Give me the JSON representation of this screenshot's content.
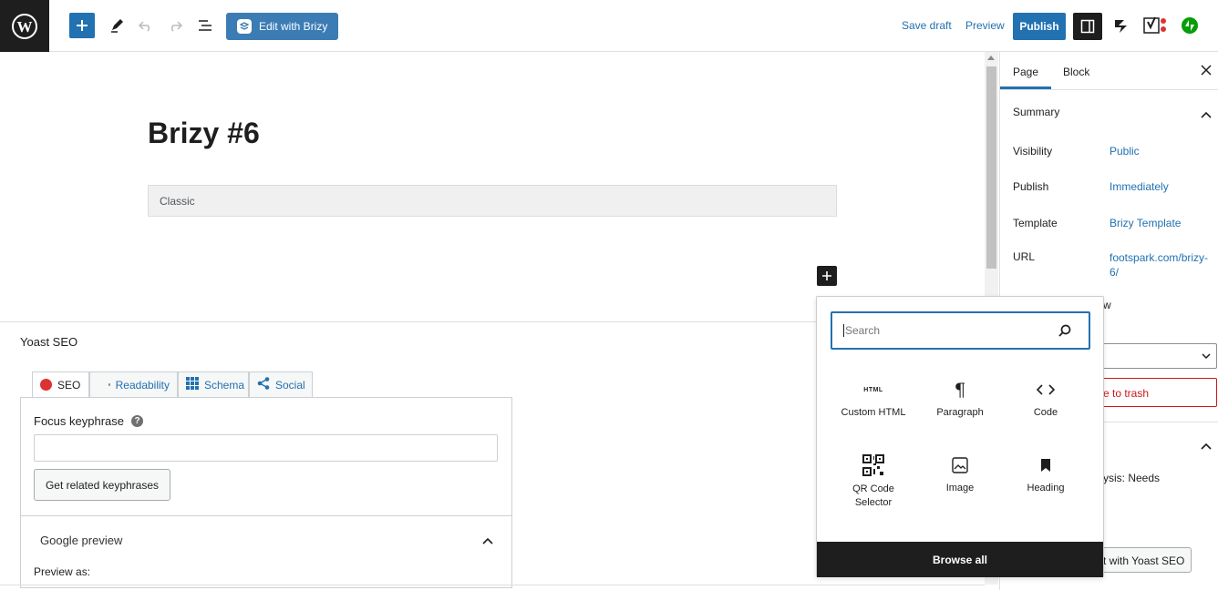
{
  "toolbar": {
    "brizy_label": "Edit with Brizy",
    "save_draft": "Save draft",
    "preview": "Preview",
    "publish": "Publish"
  },
  "editor": {
    "title": "Brizy #6",
    "classic_label": "Classic"
  },
  "yoast": {
    "title": "Yoast SEO",
    "tabs": [
      "SEO",
      "Readability",
      "Schema",
      "Social"
    ],
    "focus_label": "Focus keyphrase",
    "related_button": "Get related keyphrases",
    "google_preview": "Google preview",
    "preview_as": "Preview as:"
  },
  "sidebar": {
    "tab_page": "Page",
    "tab_block": "Block",
    "summary": "Summary",
    "rows": [
      {
        "label": "Visibility",
        "value": "Public"
      },
      {
        "label": "Publish",
        "value": "Immediately"
      },
      {
        "label": "Template",
        "value": "Brizy Template"
      },
      {
        "label": "URL",
        "value": "footspark.com/brizy-6/"
      }
    ],
    "partial_w": "w",
    "trash_partial": "e to trash",
    "analysis_partial": "ysis: Needs",
    "yoast_btn_partial": "t with Yoast SEO"
  },
  "inserter": {
    "search_placeholder": "Search",
    "blocks": [
      {
        "label": "Custom HTML",
        "icon": "html-icon"
      },
      {
        "label": "Paragraph",
        "icon": "paragraph-icon"
      },
      {
        "label": "Code",
        "icon": "code-icon"
      },
      {
        "label": "QR Code Selector",
        "icon": "qr-icon"
      },
      {
        "label": "Image",
        "icon": "image-icon"
      },
      {
        "label": "Heading",
        "icon": "bookmark-icon"
      }
    ],
    "browse_all": "Browse all",
    "html_glyph": "HTML"
  },
  "colors": {
    "accent": "#2271b1",
    "dark": "#1e1e1e",
    "seo_dot": "#dc3232",
    "trash": "#cc1818"
  }
}
